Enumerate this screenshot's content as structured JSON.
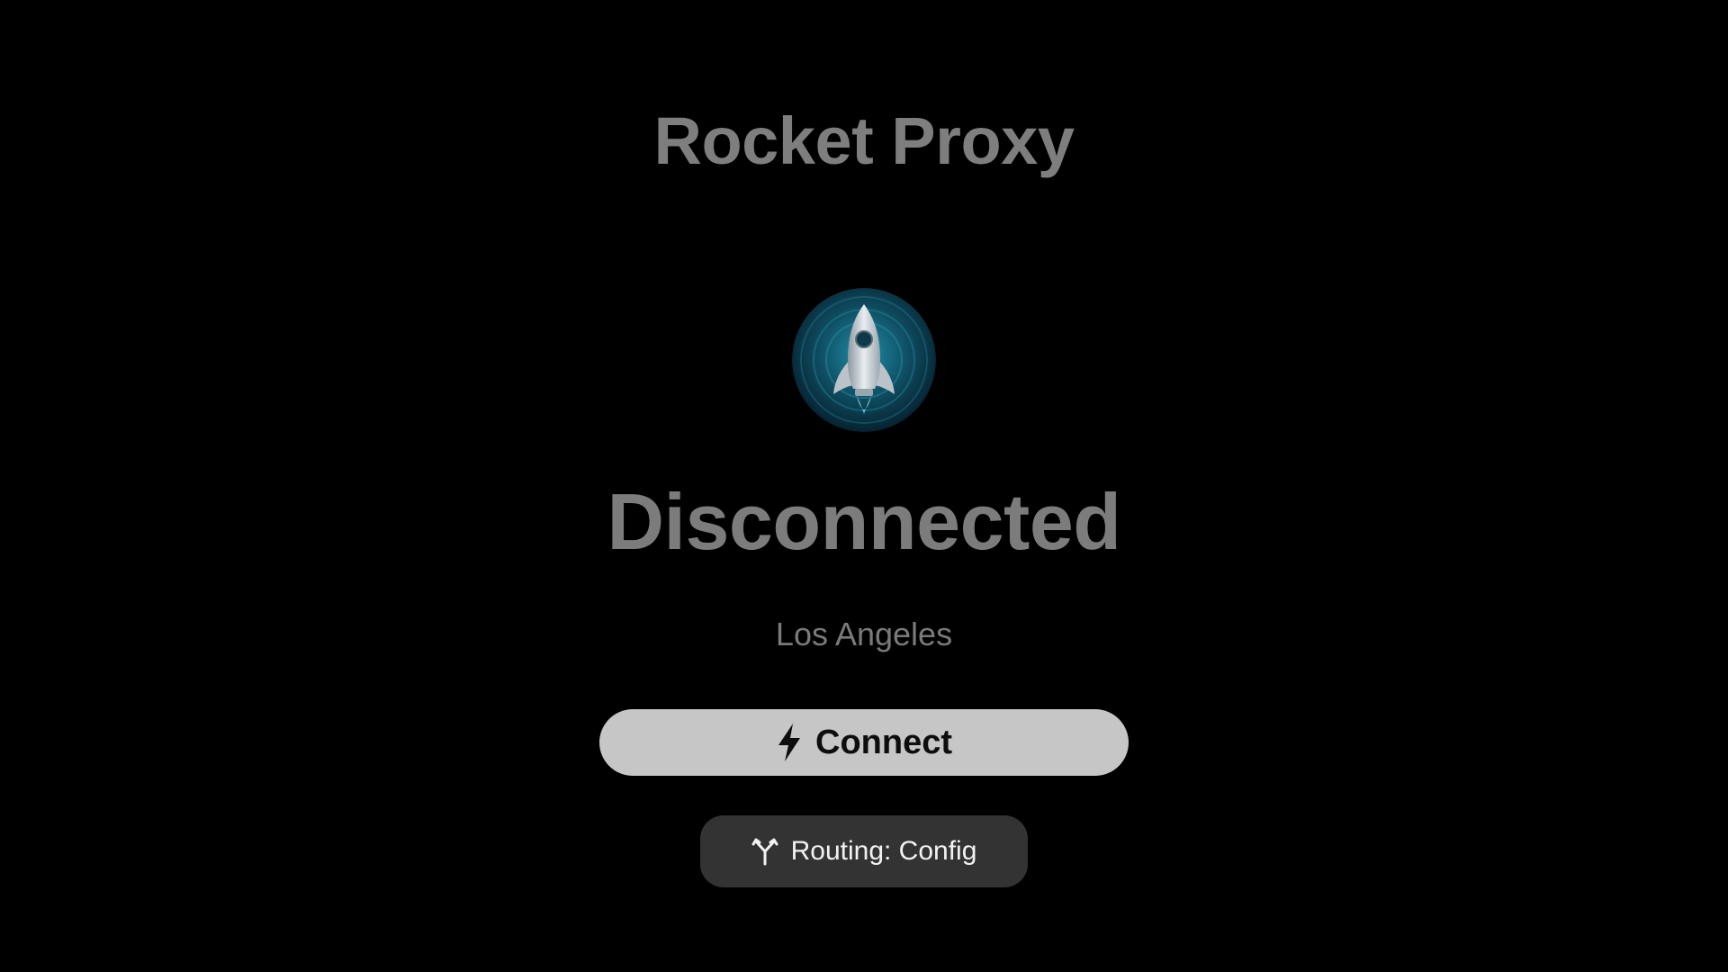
{
  "app": {
    "title": "Rocket Proxy",
    "logo_icon": "rocket-icon"
  },
  "status": {
    "label": "Disconnected",
    "location": "Los Angeles"
  },
  "actions": {
    "connect_label": "Connect",
    "connect_icon": "lightning-bolt-icon",
    "routing_label": "Routing: Config",
    "routing_icon": "branch-fork-icon"
  },
  "colors": {
    "background": "#000000",
    "logo_accent": "#1f8fa8",
    "connect_button": "#c6c6c6",
    "routing_button": "#333333"
  }
}
